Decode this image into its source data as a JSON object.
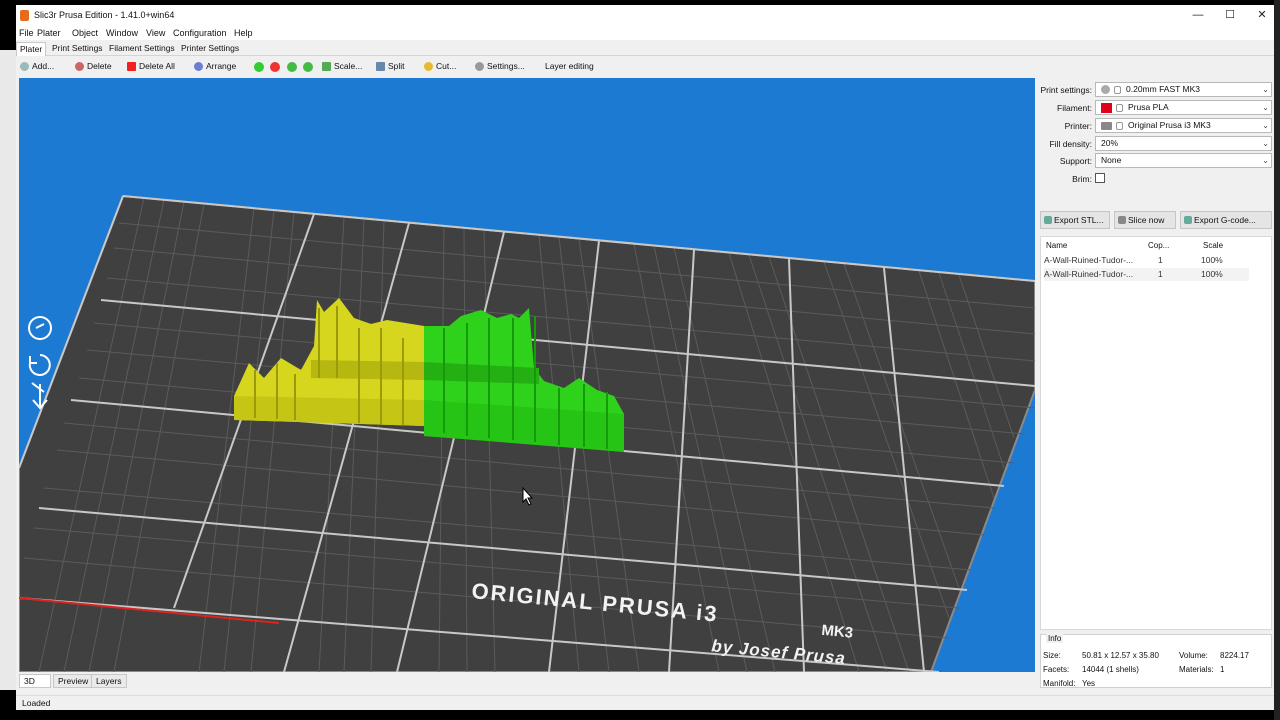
{
  "window": {
    "title": "Slic3r Prusa Edition - 1.41.0+win64",
    "minimize_glyph": "—",
    "maximize_glyph": "☐",
    "close_glyph": "✕"
  },
  "menu": [
    "File",
    "Plater",
    "Object",
    "Window",
    "View",
    "Configuration",
    "Help"
  ],
  "tabs": [
    "Plater",
    "Print Settings",
    "Filament Settings",
    "Printer Settings"
  ],
  "toolbar": {
    "add": "Add...",
    "delete": "Delete",
    "delete_all": "Delete All",
    "arrange": "Arrange",
    "scale": "Scale...",
    "split": "Split",
    "cut": "Cut...",
    "settings": "Settings...",
    "layer_editing": "Layer editing"
  },
  "viewport": {
    "bed_label_line1": "ORIGINAL PRUSA i3",
    "bed_label_model": "MK3",
    "bed_label_line2": "by Josef Prusa",
    "background": "#1d7ad3",
    "bed_color": "#3f3f3f",
    "object_left_color": "#d6d61e",
    "object_right_color": "#2fd21b"
  },
  "settings": {
    "print_label": "Print settings:",
    "print_value": "0.20mm FAST MK3",
    "filament_label": "Filament:",
    "filament_value": "Prusa PLA",
    "printer_label": "Printer:",
    "printer_value": "Original Prusa i3 MK3",
    "fill_label": "Fill density:",
    "fill_value": "20%",
    "support_label": "Support:",
    "support_value": "None",
    "brim_label": "Brim:"
  },
  "actions": {
    "export_stl": "Export STL...",
    "slice_now": "Slice now",
    "export_gcode": "Export G-code..."
  },
  "object_list": {
    "headers": {
      "name": "Name",
      "copies": "Cop...",
      "scale": "Scale"
    },
    "rows": [
      {
        "name": "A-Wall-Ruined-Tudor-...",
        "copies": "1",
        "scale": "100%"
      },
      {
        "name": "A-Wall-Ruined-Tudor-...",
        "copies": "1",
        "scale": "100%"
      }
    ]
  },
  "info": {
    "title": "Info",
    "size_label": "Size:",
    "size_value": "50.81 x 12.57 x 35.80",
    "volume_label": "Volume:",
    "volume_value": "8224.17",
    "facets_label": "Facets:",
    "facets_value": "14044 (1 shells)",
    "materials_label": "Materials:",
    "materials_value": "1",
    "manifold_label": "Manifold:",
    "manifold_value": "Yes"
  },
  "view_tabs": [
    "3D",
    "Preview",
    "Layers"
  ],
  "status": "Loaded"
}
